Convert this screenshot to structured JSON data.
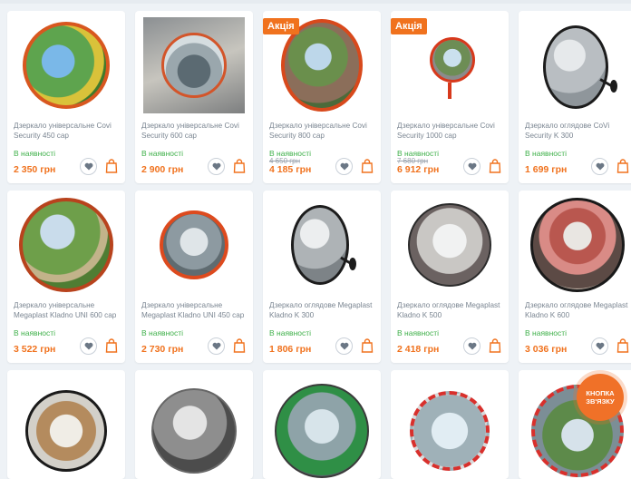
{
  "colors": {
    "accent": "#f0721e",
    "in_stock": "#3fb04a",
    "text_muted": "#7a8591"
  },
  "products": [
    {
      "name": "Дзеркало універсальне Covi Security 450 сар",
      "stock": "В наявності",
      "price": "2 350 грн",
      "old_price": "",
      "badge": ""
    },
    {
      "name": "Дзеркало універсальне Covi Security 600 сар",
      "stock": "В наявності",
      "price": "2 900 грн",
      "old_price": "",
      "badge": ""
    },
    {
      "name": "Дзеркало універсальне Covi Security 800 сар",
      "stock": "В наявності",
      "price": "4 185 грн",
      "old_price": "4 650 грн",
      "badge": "Акція"
    },
    {
      "name": "Дзеркало універсальне Covi Security 1000 сар",
      "stock": "В наявності",
      "price": "6 912 грн",
      "old_price": "7 680 грн",
      "badge": "Акція"
    },
    {
      "name": "Дзеркало оглядове CoVi Security K 300",
      "stock": "В наявності",
      "price": "1 699 грн",
      "old_price": "",
      "badge": ""
    },
    {
      "name": "Дзеркало універсальне Megaplast Kladno UNI 600 сар",
      "stock": "В наявності",
      "price": "3 522 грн",
      "old_price": "",
      "badge": ""
    },
    {
      "name": "Дзеркало універсальне Megaplast Kladno UNI 450 сар",
      "stock": "В наявності",
      "price": "2 730 грн",
      "old_price": "",
      "badge": ""
    },
    {
      "name": "Дзеркало оглядове Megaplast Kladno K 300",
      "stock": "В наявності",
      "price": "1 806 грн",
      "old_price": "",
      "badge": ""
    },
    {
      "name": "Дзеркало оглядове Megaplast Kladno K 500",
      "stock": "В наявності",
      "price": "2 418 грн",
      "old_price": "",
      "badge": ""
    },
    {
      "name": "Дзеркало оглядове Megaplast Kladno K 600",
      "stock": "В наявності",
      "price": "3 036 грн",
      "old_price": "",
      "badge": ""
    }
  ],
  "callback": {
    "line1": "КНОПКА",
    "line2": "ЗВ'ЯЗКУ"
  }
}
